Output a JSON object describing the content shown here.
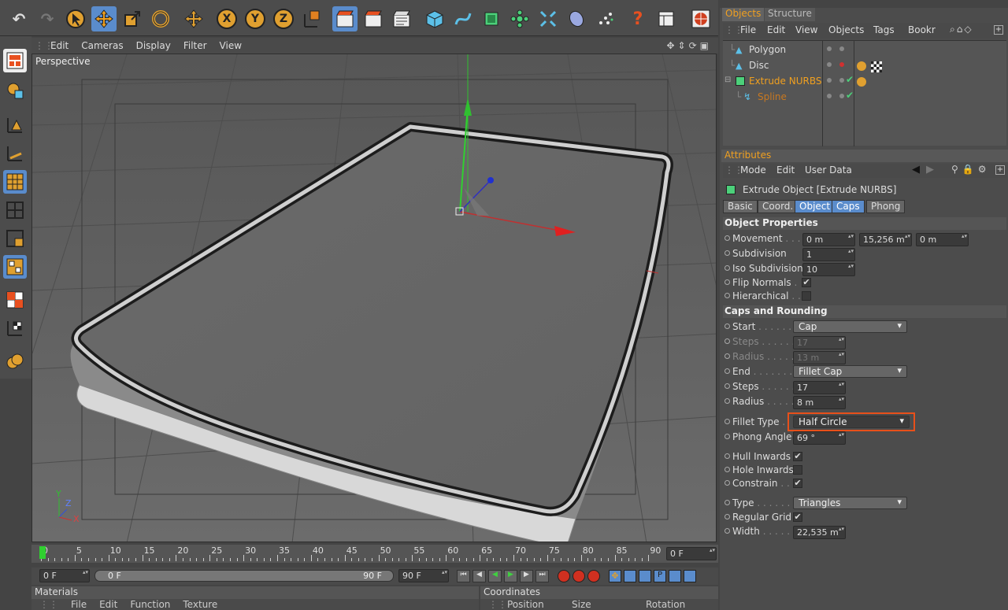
{
  "toolbar": {
    "icons": [
      "undo-icon",
      "redo-icon",
      "select-cursor-icon",
      "move-icon",
      "scale-icon",
      "rotate-icon",
      "move-add-icon",
      "x-axis-icon",
      "y-axis-icon",
      "z-axis-icon",
      "coordinate-system-icon",
      "render-view-icon",
      "render-picture-viewer-icon",
      "render-settings-icon",
      "cube-icon",
      "spline-pen-icon",
      "nurbs-icon",
      "array-icon",
      "deformer-icon",
      "scene-icon",
      "camera-icon",
      "help-icon",
      "layout-icon",
      "web-icon"
    ],
    "axis_x": "X",
    "axis_y": "Y",
    "axis_z": "Z"
  },
  "viewport": {
    "menu": [
      "Edit",
      "Cameras",
      "Display",
      "Filter",
      "View"
    ],
    "label": "Perspective",
    "axis_labels": {
      "y": "Y",
      "z": "Z",
      "x": "X"
    }
  },
  "timeline": {
    "ticks": [
      "0",
      "5",
      "10",
      "15",
      "20",
      "25",
      "30",
      "35",
      "40",
      "45",
      "50",
      "55",
      "60",
      "65",
      "70",
      "75",
      "80",
      "85",
      "90"
    ],
    "current_frame": "0 F",
    "start_field": "0 F",
    "range_left": "0 F",
    "range_right": "90 F",
    "end_field": "90 F"
  },
  "materials": {
    "title": "Materials",
    "menu": [
      "File",
      "Edit",
      "Function",
      "Texture"
    ]
  },
  "coordinates": {
    "title": "Coordinates",
    "columns": [
      "Position",
      "Size",
      "Rotation"
    ]
  },
  "objects_panel": {
    "tabs": [
      "Objects",
      "Structure"
    ],
    "menu": [
      "File",
      "Edit",
      "View",
      "Objects",
      "Tags",
      "Bookr"
    ],
    "items": [
      {
        "name": "Polygon",
        "color": "#dddddd"
      },
      {
        "name": "Disc",
        "color": "#dddddd"
      },
      {
        "name": "Extrude NURBS",
        "color": "#f0a020"
      },
      {
        "name": "Spline",
        "color": "#c87820"
      }
    ]
  },
  "attributes": {
    "title": "Attributes",
    "menu": [
      "Mode",
      "Edit",
      "User Data"
    ],
    "object_title": "Extrude Object [Extrude NURBS]",
    "tabs": [
      "Basic",
      "Coord.",
      "Object",
      "Caps",
      "Phong"
    ],
    "sections": {
      "object_properties": "Object Properties",
      "caps": "Caps and Rounding"
    },
    "movement": {
      "label": "Movement",
      "x": "0 m",
      "y": "15,256 m",
      "z": "0 m"
    },
    "subdivision": {
      "label": "Subdivision",
      "value": "1"
    },
    "iso_subdivision": {
      "label": "Iso Subdivision",
      "value": "10"
    },
    "flip_normals": {
      "label": "Flip Normals",
      "checked": "✔"
    },
    "hierarchical": {
      "label": "Hierarchical",
      "checked": ""
    },
    "start": {
      "label": "Start",
      "value": "Cap"
    },
    "steps_start": {
      "label": "Steps",
      "value": "17"
    },
    "radius_start": {
      "label": "Radius",
      "value": "13 m"
    },
    "end": {
      "label": "End",
      "value": "Fillet Cap"
    },
    "steps_end": {
      "label": "Steps",
      "value": "17"
    },
    "radius_end": {
      "label": "Radius",
      "value": "8 m"
    },
    "fillet_type": {
      "label": "Fillet Type",
      "value": "Half Circle"
    },
    "phong_angle": {
      "label": "Phong Angle",
      "value": "69 °"
    },
    "hull_inwards": {
      "label": "Hull Inwards",
      "checked": "✔"
    },
    "hole_inwards": {
      "label": "Hole Inwards",
      "checked": ""
    },
    "constrain": {
      "label": "Constrain",
      "checked": "✔"
    },
    "type": {
      "label": "Type",
      "value": "Triangles"
    },
    "regular_grid": {
      "label": "Regular Grid",
      "checked": "✔"
    },
    "width": {
      "label": "Width",
      "value": "22,535 m"
    },
    "highlight_color": "#e8501a"
  }
}
